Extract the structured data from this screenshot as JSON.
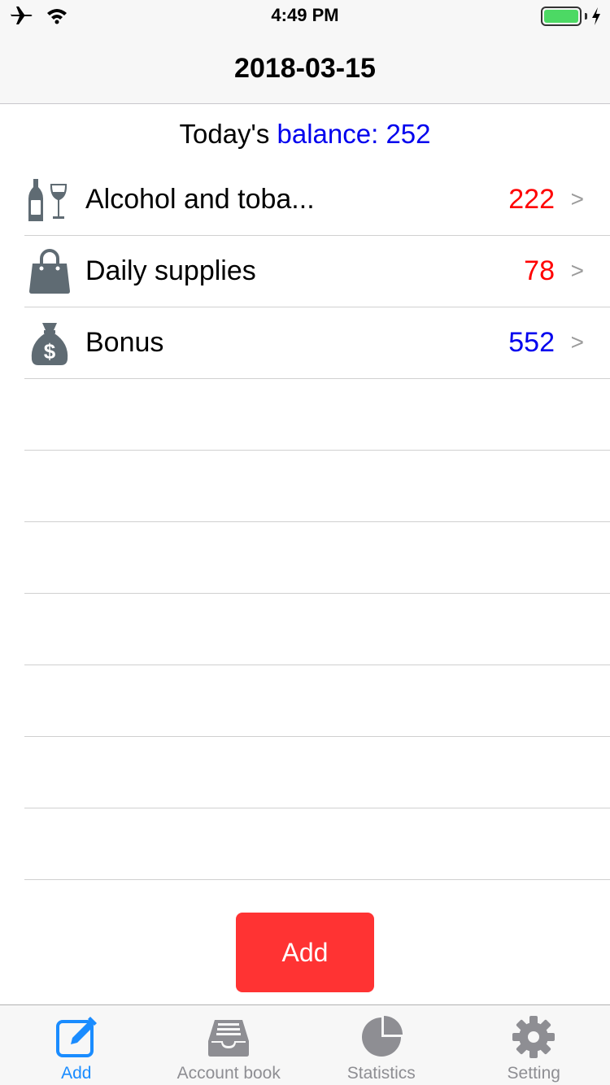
{
  "status_bar": {
    "time": "4:49 PM",
    "battery_level": 1.0
  },
  "nav": {
    "title": "2018-03-15"
  },
  "balance": {
    "prefix": "Today's ",
    "label": "balance: 252"
  },
  "entries": [
    {
      "icon": "wine-bottle-icon",
      "label": "Alcohol and toba...",
      "amount": "222",
      "type": "expense",
      "chevron": ">"
    },
    {
      "icon": "shopping-bag-icon",
      "label": "Daily supplies",
      "amount": "78",
      "type": "expense",
      "chevron": ">"
    },
    {
      "icon": "money-bag-icon",
      "label": "Bonus",
      "amount": "552",
      "type": "income",
      "chevron": ">"
    }
  ],
  "add_button": {
    "label": "Add"
  },
  "tabs": [
    {
      "icon": "edit-icon",
      "label": "Add",
      "active": true
    },
    {
      "icon": "inbox-tray-icon",
      "label": "Account book",
      "active": false
    },
    {
      "icon": "pie-chart-icon",
      "label": "Statistics",
      "active": false
    },
    {
      "icon": "gear-icon",
      "label": "Setting",
      "active": false
    }
  ],
  "colors": {
    "expense": "#ff0000",
    "income": "#0000ee",
    "accent": "#1a8cff",
    "add_button": "#ff3333"
  }
}
